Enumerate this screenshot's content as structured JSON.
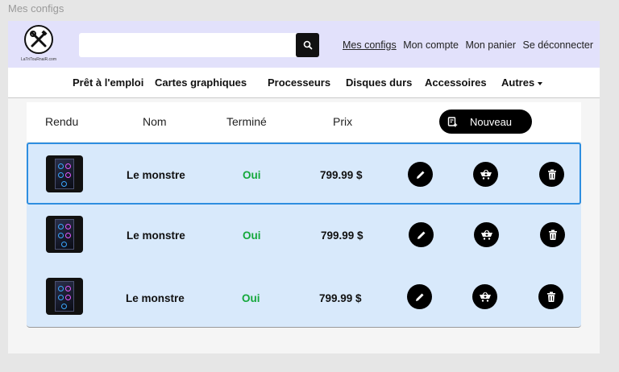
{
  "frame_title": "Mes configs",
  "logo": {
    "caption": "LaTriTouRnaiR.com",
    "icon": "tools-icon"
  },
  "search": {
    "value": "",
    "placeholder": "",
    "icon": "search-icon"
  },
  "toplinks": [
    "Mes configs",
    "Mon compte",
    "Mon panier",
    "Se déconnecter"
  ],
  "nav": {
    "items": [
      "Prêt à l'emploi",
      "Cartes graphiques",
      "Processeurs",
      "Disques durs",
      "Accessoires",
      "Autres"
    ]
  },
  "table": {
    "headers": [
      "Rendu",
      "Nom",
      "Terminé",
      "Prix"
    ],
    "new_button": "Nouveau",
    "rows": [
      {
        "name": "Le monstre",
        "done": "Oui",
        "price": "799.99 $"
      },
      {
        "name": "Le monstre",
        "done": "Oui",
        "price": "799.99 $"
      },
      {
        "name": "Le monstre",
        "done": "Oui",
        "price": "799.99 $"
      }
    ]
  },
  "colors": {
    "header_bg": "#e2e1fb",
    "row_bg": "#d8e9fb",
    "selected_border": "#2e8ee0",
    "done_green": "#14a83b"
  }
}
